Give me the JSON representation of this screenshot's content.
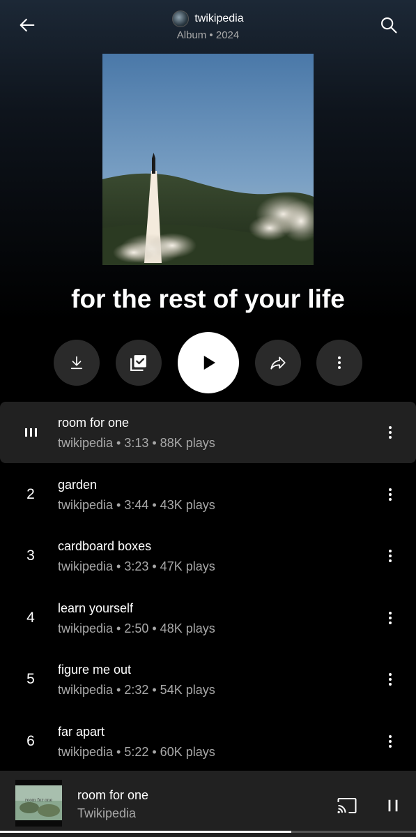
{
  "header": {
    "artist": "twikipedia",
    "subtitle": "Album • 2024"
  },
  "album": {
    "title": "for the rest of your life"
  },
  "actions": {
    "download_icon": "download-icon",
    "save_icon": "library-add-check-icon",
    "play_icon": "play-icon",
    "share_icon": "share-icon",
    "more_icon": "more-vert-icon"
  },
  "tracks": [
    {
      "num": "",
      "title": "room for one",
      "meta": "twikipedia • 3:13 • 88K plays",
      "playing": true
    },
    {
      "num": "2",
      "title": "garden",
      "meta": "twikipedia • 3:44 • 43K plays",
      "playing": false
    },
    {
      "num": "3",
      "title": "cardboard boxes",
      "meta": "twikipedia • 3:23 • 47K plays",
      "playing": false
    },
    {
      "num": "4",
      "title": "learn yourself",
      "meta": "twikipedia • 2:50 • 48K plays",
      "playing": false
    },
    {
      "num": "5",
      "title": "figure me out",
      "meta": "twikipedia • 2:32 • 54K plays",
      "playing": false
    },
    {
      "num": "6",
      "title": "far apart",
      "meta": "twikipedia • 5:22 • 60K plays",
      "playing": false
    }
  ],
  "miniplayer": {
    "title": "room for one",
    "artist": "Twikipedia",
    "thumb_text": "room for one",
    "progress": 0.7
  },
  "colors": {
    "background": "#000000",
    "active_row": "#212121",
    "secondary_text": "#a8a8a8"
  }
}
